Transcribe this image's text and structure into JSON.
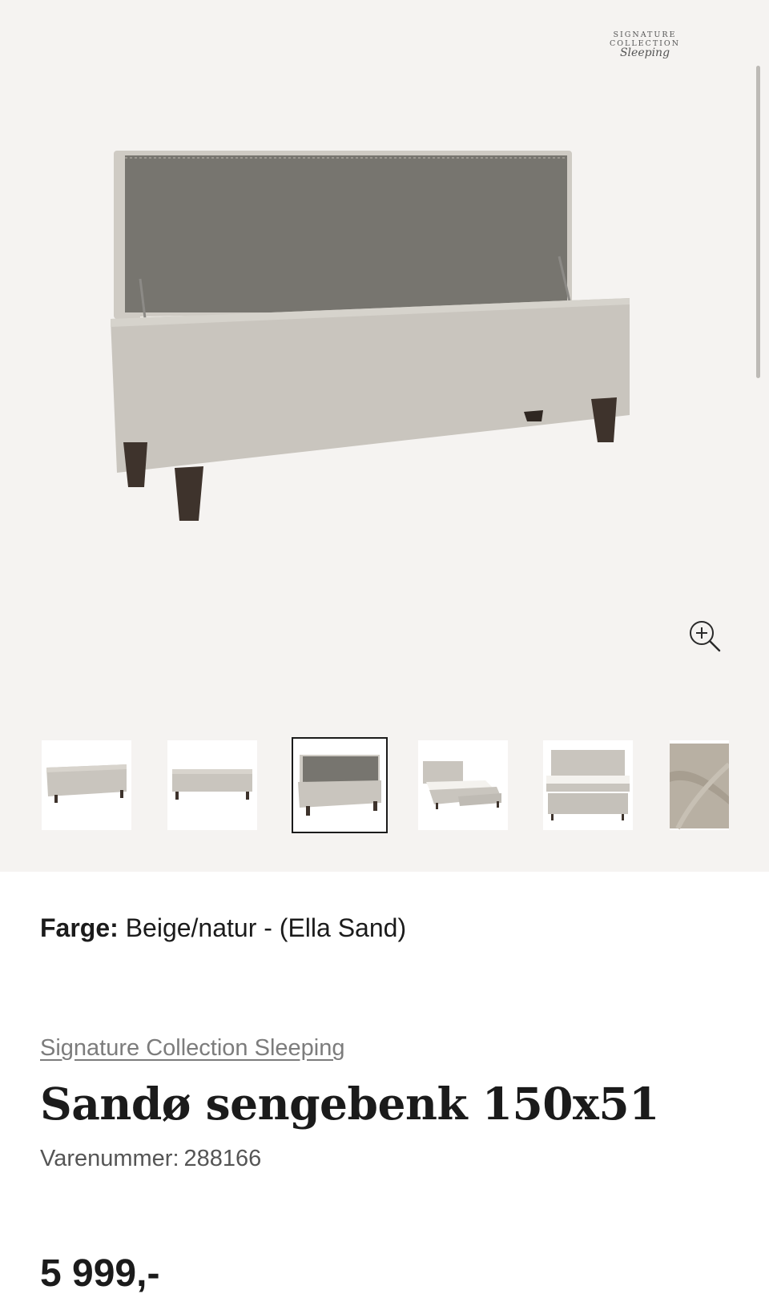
{
  "brand_logo": {
    "line1": "SIGNATURE COLLECTION",
    "line2": "Sleeping"
  },
  "gallery": {
    "selected_index": 2,
    "thumbnails": [
      {
        "name": "bench-closed-angle"
      },
      {
        "name": "bench-closed-front"
      },
      {
        "name": "bench-open"
      },
      {
        "name": "bed-with-bench-angle"
      },
      {
        "name": "bed-with-bench-front"
      },
      {
        "name": "fabric-swatch"
      }
    ]
  },
  "color": {
    "label": "Farge:",
    "value": "Beige/natur - (Ella Sand)"
  },
  "product": {
    "brand": "Signature Collection Sleeping",
    "title": "Sandø sengebenk 150x51",
    "sku_label": "Varenummer:",
    "sku_value": "288166",
    "price": "5 999,-"
  },
  "colors": {
    "fabric": "#c9c5be",
    "lid_inner": "#77756f",
    "legs": "#3e332c",
    "background": "#f5f3f1"
  }
}
